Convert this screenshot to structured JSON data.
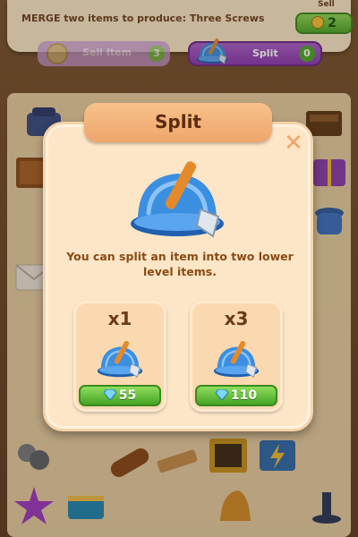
{
  "header": {
    "quest": "MERGE two items to produce:  Three Screws",
    "sell_label": "Sell",
    "sell_value": "2"
  },
  "actions": {
    "sell_text": "Sell Item",
    "sell_count": "3",
    "split_text": "Split",
    "split_count": "0"
  },
  "board": {
    "items": [
      "phone-icon",
      "book-icon",
      "box-icon",
      "gift-icon",
      "pot-icon",
      "letter-icon",
      "rock-icon",
      "log-icon",
      "plank-icon",
      "frame-icon",
      "lightning-crate-icon",
      "star-icon",
      "cake-icon",
      "bell-icon",
      "candle-icon"
    ]
  },
  "modal": {
    "title": "Split",
    "description": "You can split an item into two lower level items.",
    "options": [
      {
        "multiplier": "x1",
        "price": "55"
      },
      {
        "multiplier": "x3",
        "price": "110"
      }
    ]
  },
  "colors": {
    "modal_bg": "#fde6c7",
    "title_bg": "#eea66c",
    "price_green": "#46a326",
    "hat_blue": "#3b8fe0",
    "hammer_orange": "#e58a2a"
  }
}
